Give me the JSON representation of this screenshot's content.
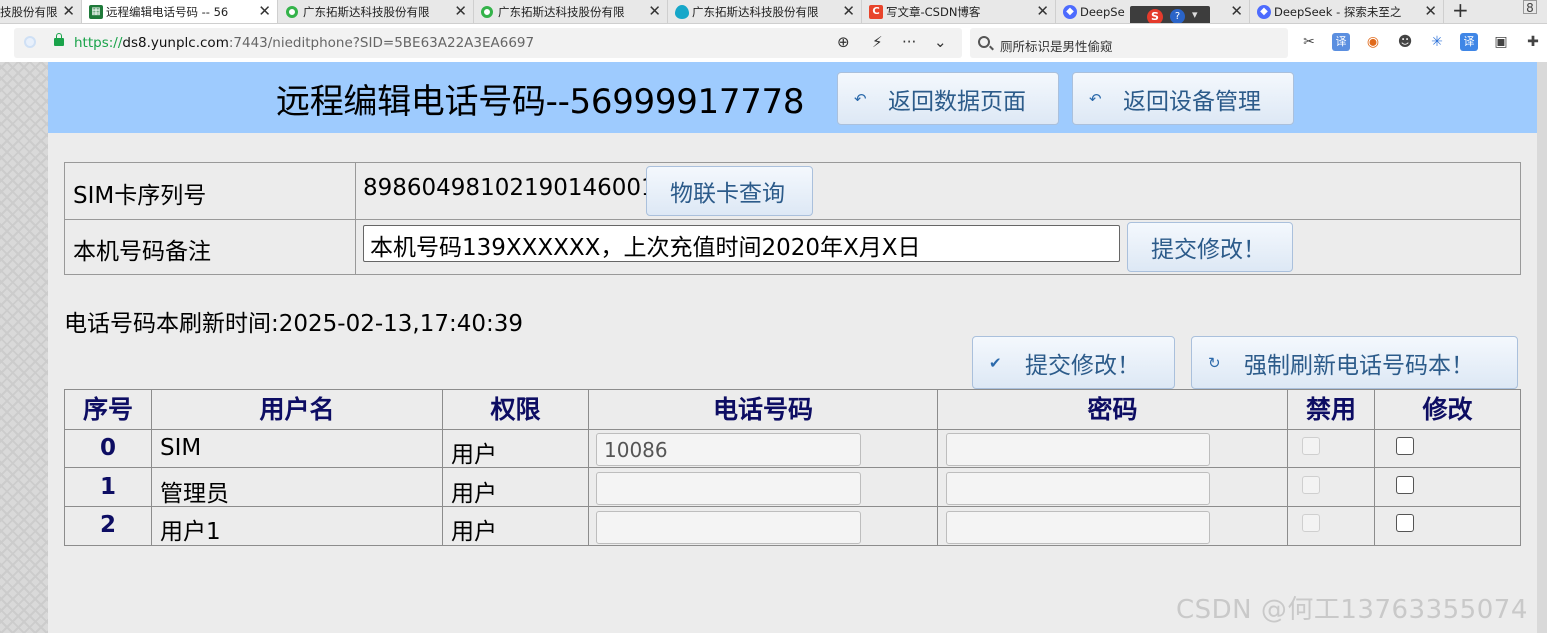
{
  "browser": {
    "tabs": [
      {
        "title": "技股份有限",
        "icon": "globe-icon",
        "color": "#888888"
      },
      {
        "title": "远程编辑电话号码 -- 56",
        "icon": "spreadsheet-icon",
        "color": "#1f7a3a"
      },
      {
        "title": "广东拓斯达科技股份有限",
        "icon": "green-circle-icon",
        "color": "#34b34a"
      },
      {
        "title": "广东拓斯达科技股份有限",
        "icon": "green-circle-icon",
        "color": "#34b34a"
      },
      {
        "title": "广东拓斯达科技股份有限",
        "icon": "water-drop-icon",
        "color": "#16a7c9"
      },
      {
        "title": "写文章-CSDN博客",
        "icon": "csdn-icon",
        "color": "#e8442b"
      },
      {
        "title": "DeepSe",
        "icon": "deepseek-whale-icon",
        "color": "#4d6bfe"
      },
      {
        "title": "DeepSeek - 探索未至之",
        "icon": "deepseek-whale-icon",
        "color": "#4d6bfe"
      }
    ],
    "window_corner": "8",
    "ime_logo": "S",
    "ime_help": "?",
    "url": {
      "protocol": "https://",
      "domain": "ds8.yunplc.com",
      "path": ":7443/nieditphone?SID=5BE63A22A3EA6697"
    },
    "search_placeholder": "厕所标识是男性偷窥"
  },
  "page": {
    "title": "远程编辑电话号码--56999917778",
    "back_data_button": "返回数据页面",
    "back_device_button": "返回设备管理",
    "sim_label": "SIM卡序列号",
    "sim_value": "89860498102190146001",
    "iot_query_button": "物联卡查询",
    "note_label": "本机号码备注",
    "note_value": "本机号码139XXXXXX，上次充值时间2020年X月X日",
    "submit_note_button": "提交修改！",
    "refresh_time": "电话号码本刷新时间:2025-02-13,17:40:39",
    "submit_button": "提交修改！",
    "force_refresh_button": "强制刷新电话号码本！"
  },
  "phonebook": {
    "columns": [
      "序号",
      "用户名",
      "权限",
      "电话号码",
      "密码",
      "禁用",
      "修改"
    ],
    "rows": [
      {
        "index": "0",
        "username": "SIM",
        "role": "用户",
        "phone": "10086",
        "password": "",
        "disabled": false,
        "modify": false
      },
      {
        "index": "1",
        "username": "管理员",
        "role": "用户",
        "phone": "",
        "password": "",
        "disabled": false,
        "modify": false
      },
      {
        "index": "2",
        "username": "用户1",
        "role": "用户",
        "phone": "",
        "password": "",
        "disabled": false,
        "modify": false
      }
    ]
  },
  "watermark": "CSDN @何工13763355074"
}
